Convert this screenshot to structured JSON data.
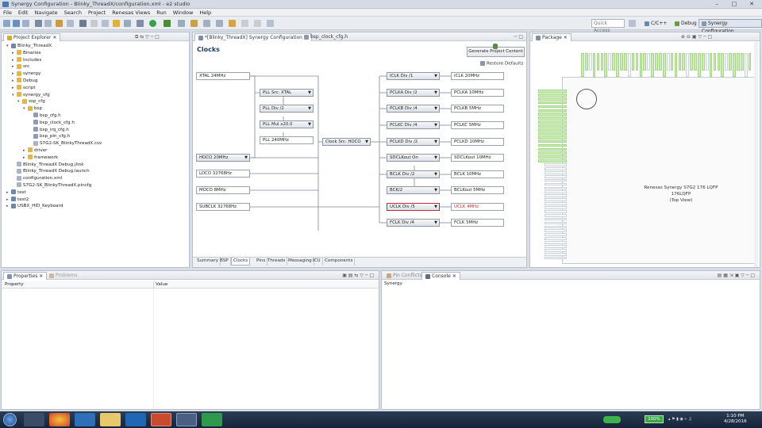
{
  "window": {
    "title": "Synergy Configuration - Blinky_ThreadX/configuration.xml - e2 studio"
  },
  "menu": [
    "File",
    "Edit",
    "Navigate",
    "Search",
    "Project",
    "Renesas Views",
    "Run",
    "Window",
    "Help"
  ],
  "toolbar": {
    "quick_access": "Quick Access",
    "perspectives": [
      "C/C++",
      "Debug",
      "Synergy Configuration"
    ]
  },
  "project_explorer": {
    "title": "Project Explorer",
    "items": [
      {
        "label": "Blinky_ThreadX",
        "depth": 0,
        "tw": "▾",
        "icon": "project-icon"
      },
      {
        "label": "Binaries",
        "depth": 1,
        "tw": "▸",
        "icon": "folder-icon"
      },
      {
        "label": "Includes",
        "depth": 1,
        "tw": "▸",
        "icon": "folder-icon"
      },
      {
        "label": "src",
        "depth": 1,
        "tw": "▸",
        "icon": "folder-icon"
      },
      {
        "label": "synergy",
        "depth": 1,
        "tw": "▸",
        "icon": "folder-icon"
      },
      {
        "label": "Debug",
        "depth": 1,
        "tw": "▸",
        "icon": "folder-icon"
      },
      {
        "label": "script",
        "depth": 1,
        "tw": "▸",
        "icon": "folder-icon"
      },
      {
        "label": "synergy_cfg",
        "depth": 1,
        "tw": "▾",
        "icon": "folder-icon"
      },
      {
        "label": "ssp_cfg",
        "depth": 2,
        "tw": "▾",
        "icon": "folder-icon"
      },
      {
        "label": "bsp",
        "depth": 3,
        "tw": "▾",
        "icon": "folder-icon"
      },
      {
        "label": "bsp_cfg.h",
        "depth": 4,
        "tw": "",
        "icon": "header-file-icon"
      },
      {
        "label": "bsp_clock_cfg.h",
        "depth": 4,
        "tw": "",
        "icon": "header-file-icon"
      },
      {
        "label": "bsp_irq_cfg.h",
        "depth": 4,
        "tw": "",
        "icon": "header-file-icon"
      },
      {
        "label": "bsp_pin_cfg.h",
        "depth": 4,
        "tw": "",
        "icon": "header-file-icon"
      },
      {
        "label": "S7G2-SK_BlinkyThreadX.csv",
        "depth": 4,
        "tw": "",
        "icon": "file-icon"
      },
      {
        "label": "driver",
        "depth": 3,
        "tw": "▸",
        "icon": "folder-icon"
      },
      {
        "label": "framework",
        "depth": 3,
        "tw": "▸",
        "icon": "folder-icon"
      },
      {
        "label": "Blinky_ThreadX Debug.jlink",
        "depth": 1,
        "tw": "",
        "icon": "file-icon"
      },
      {
        "label": "Blinky_ThreadX Debug.launch",
        "depth": 1,
        "tw": "",
        "icon": "file-icon"
      },
      {
        "label": "configuration.xml",
        "depth": 1,
        "tw": "",
        "icon": "file-icon"
      },
      {
        "label": "S7G2-SK_BlinkyThreadX.pincfg",
        "depth": 1,
        "tw": "",
        "icon": "file-icon"
      },
      {
        "label": "test",
        "depth": 0,
        "tw": "▸",
        "icon": "project-icon"
      },
      {
        "label": "test2",
        "depth": 0,
        "tw": "▸",
        "icon": "project-icon"
      },
      {
        "label": "USBX_HID_Keyboard",
        "depth": 0,
        "tw": "▸",
        "icon": "project-icon"
      }
    ]
  },
  "editor": {
    "tabs": [
      "*[Blinky_ThreadX] Synergy Configuration",
      "bsp_clock_cfg.h"
    ],
    "heading": "Clocks",
    "generate_button": "Generate Project Content",
    "restore_defaults": "Restore Defaults",
    "bottom_tabs": [
      "Summary",
      "BSP",
      "Clocks",
      "Pins",
      "Threads",
      "Messaging",
      "ICU",
      "Components"
    ],
    "clocks": {
      "xtal": "XTAL 24MHz",
      "hoco": "HOCO 20MHz",
      "loco": "LOCO 32768Hz",
      "moco": "MOCO 8MHz",
      "subclk": "SUBCLK 32768Hz",
      "pll_src": "PLL Src: XTAL",
      "pll_div": "PLL Div /2",
      "pll_mul": "PLL Mul x20.0",
      "pll_out": "PLL 240MHz",
      "clock_src": "Clock Src: HOCO",
      "dividers": [
        {
          "div": "ICLK Div /1",
          "out": "ICLK 20MHz"
        },
        {
          "div": "PCLKA Div /2",
          "out": "PCLKA 10MHz"
        },
        {
          "div": "PCLKB Div /4",
          "out": "PCLKB 5MHz"
        },
        {
          "div": "PCLKC Div /4",
          "out": "PCLKC 5MHz"
        },
        {
          "div": "PCLKD Div /2",
          "out": "PCLKD 10MHz"
        },
        {
          "div": "SDCLKout On",
          "out": "SDCLKout 10MHz"
        },
        {
          "div": "BCLK Div /2",
          "out": "BCLK 10MHz"
        },
        {
          "div": "BCK/2",
          "out": "BCLKout 5MHz"
        },
        {
          "div": "UCLK Div /5",
          "out": "UCLK 4MHz"
        },
        {
          "div": "FCLK Div /4",
          "out": "FCLK 5MHz"
        }
      ]
    }
  },
  "package": {
    "title": "Package",
    "chip_line1": "Renesas Synergy S7G2 176 LQFP",
    "chip_line2": "176LQFP",
    "chip_line3": "(Top View)"
  },
  "properties": {
    "tabs": [
      "Properties",
      "Problems"
    ],
    "columns": [
      "Property",
      "Value"
    ]
  },
  "console": {
    "tabs": [
      "Pin Conflicts",
      "Console"
    ],
    "text": "Synergy"
  },
  "taskbar": {
    "battery": "100%",
    "time": "1:10 PM",
    "date": "4/28/2016"
  },
  "colors": {
    "selected_border": "#c2262e",
    "uclk_text": "#d03030",
    "pin_green": "#c8efb0"
  }
}
